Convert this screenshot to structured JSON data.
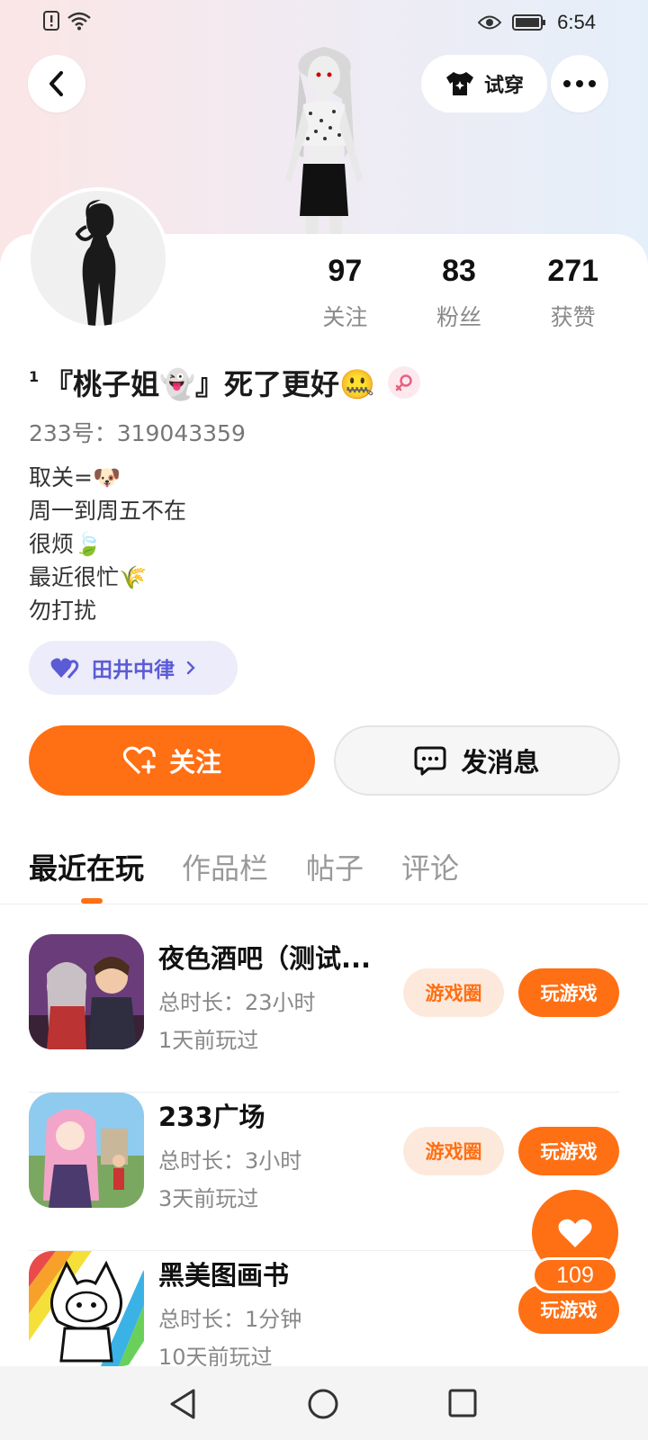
{
  "status_bar": {
    "time": "6:54",
    "icons": [
      "alert-icon",
      "wifi-icon",
      "eye-icon",
      "battery-icon"
    ]
  },
  "header": {
    "try_on_label": "试穿"
  },
  "stats": [
    {
      "value": "97",
      "label": "关注"
    },
    {
      "value": "83",
      "label": "粉丝"
    },
    {
      "value": "271",
      "label": "获赞"
    }
  ],
  "profile": {
    "level": "1",
    "name": "『桃子姐👻』死了更好🤐",
    "uid": "233号：319043359",
    "bio": [
      "取关=🐶",
      "周一到周五不在",
      "很烦🍃",
      "最近很忙🌾",
      "勿打扰"
    ],
    "tag": "田井中律"
  },
  "actions": {
    "follow_label": "关注",
    "message_label": "发消息"
  },
  "tabs": [
    "最近在玩",
    "作品栏",
    "帖子",
    "评论"
  ],
  "games": [
    {
      "title": "夜色酒吧（测试...",
      "duration": "总时长：23小时",
      "last_played": "1天前玩过",
      "circle_label": "游戏圈",
      "play_label": "玩游戏"
    },
    {
      "title": "233广场",
      "duration": "总时长：3小时",
      "last_played": "3天前玩过",
      "circle_label": "游戏圈",
      "play_label": "玩游戏"
    },
    {
      "title": "黑美图画书",
      "duration": "总时长：1分钟",
      "last_played": "10天前玩过",
      "circle_label": "",
      "play_label": "玩游戏"
    }
  ],
  "like_fab": {
    "count": "109"
  },
  "colors": {
    "accent": "#ff6f13",
    "tag_text": "#5b5bd6"
  }
}
